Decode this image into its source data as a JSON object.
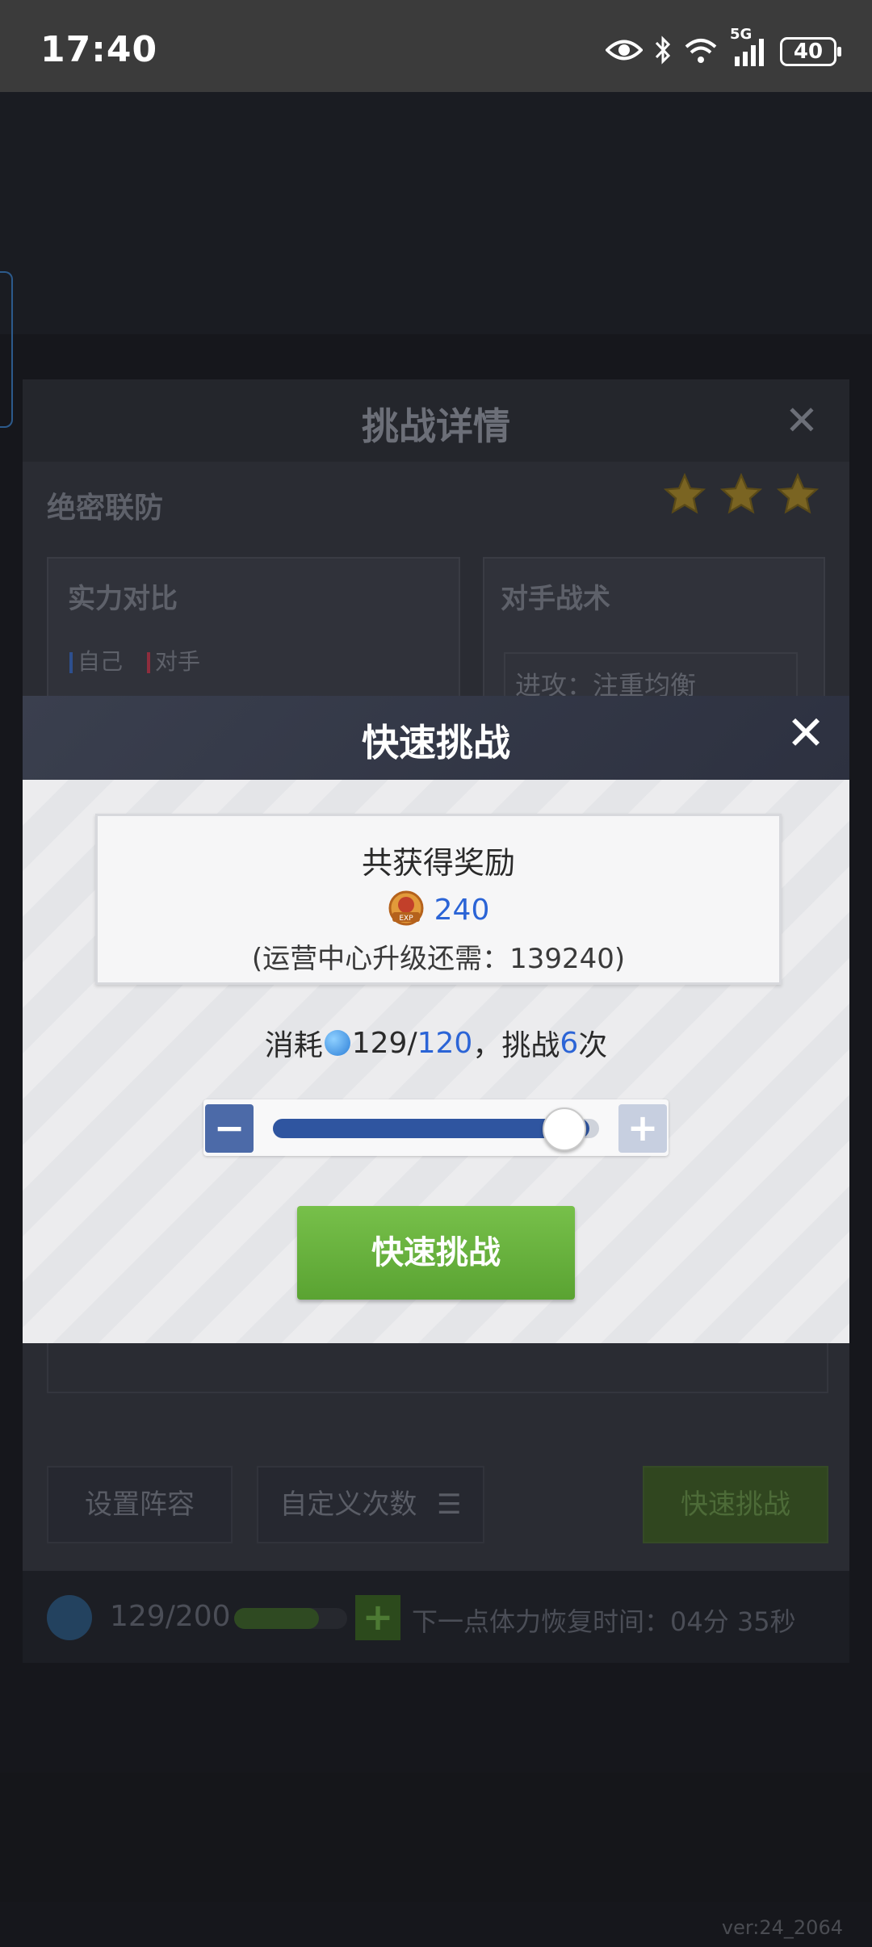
{
  "status_bar": {
    "time": "17:40",
    "network": "5G",
    "battery": "40"
  },
  "background": {
    "detail_panel": {
      "title": "挑战详情",
      "close_icon": "close-icon",
      "stage_name": "绝密联防",
      "stars": 3,
      "strength_title": "实力对比",
      "legend_self": "自己",
      "legend_opponent": "对手",
      "tactics_title": "对手战术",
      "tactics_attack": "进攻：注重均衡",
      "buttons": {
        "lineup": "设置阵容",
        "custom_count": "自定义次数",
        "quick_challenge": "快速挑战"
      }
    },
    "stamina": {
      "value": "129/200",
      "recovery_text": "下一点体力恢复时间：04分 35秒"
    },
    "version": "ver:24_2064"
  },
  "modal": {
    "title": "快速挑战",
    "reward_title": "共获得奖励",
    "reward_icon": "exp-badge-icon",
    "reward_value": "240",
    "upgrade_note": "(运营中心升级还需：139240)",
    "consume_prefix": "消耗",
    "consume_current": "129/",
    "consume_required": "120",
    "consume_mid": "，挑战",
    "challenge_times": "6",
    "consume_suffix": "次",
    "slider_level": 1.0,
    "minus_label": "−",
    "plus_label": "+",
    "confirm_label": "快速挑战"
  },
  "colors": {
    "accent_blue": "#2b64d6",
    "button_green": "#6cb43f",
    "slider_fill": "#2f55a0"
  }
}
